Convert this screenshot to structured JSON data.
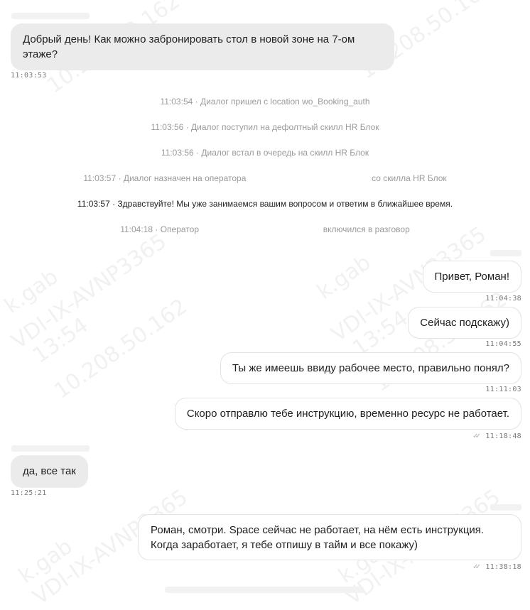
{
  "messages": [
    {
      "text": "Добрый день! Как можно забронировать стол в новой зоне на 7-ом этаже?",
      "time": "11:03:53"
    },
    {
      "text": "Привет, Роман!",
      "time": "11:04:38"
    },
    {
      "text": "Сейчас подскажу)",
      "time": "11:04:55"
    },
    {
      "text": "Ты же имеешь ввиду рабочее место, правильно понял?",
      "time": "11:11:03"
    },
    {
      "text": "Скоро отправлю тебе инструкцию, временно ресурс не работает.",
      "time": "11:18:48"
    },
    {
      "text": "да, все так",
      "time": "11:25:21"
    },
    {
      "text": "Роман, смотри. Space сейчас не работает, на нём есть инструкция. Когда заработает, я тебе отпишу в тайм и все покажу)",
      "time": "11:38:18"
    }
  ],
  "system": [
    {
      "text": "11:03:54 · Диалог пришел с location wo_Booking_auth"
    },
    {
      "text": "11:03:56 · Диалог поступил на дефолтный скилл HR Блок"
    },
    {
      "text": "11:03:56 · Диалог встал в очередь на скилл HR Блок"
    },
    {
      "prefix": "11:03:57 · Диалог назначен на оператора",
      "suffix": "со скилла HR Блок"
    },
    {
      "text": "11:03:57 · Здравствуйте! Мы уже занимаемся вашим вопросом и ответим в ближайшее время."
    },
    {
      "prefix": "11:04:18 · Оператор",
      "suffix": "включился в разговор"
    }
  ],
  "watermarks": [
    {
      "text": "VDI-IX-AVNP3365"
    },
    {
      "text": "k.gab"
    },
    {
      "text": "13:54"
    },
    {
      "text": "10.208.50.162"
    }
  ],
  "colors": {
    "incoming_bubble": "#ebebeb",
    "outgoing_border": "#e3e3e3",
    "system_text": "#9a9a9a",
    "timestamp": "#7a7a7a"
  }
}
